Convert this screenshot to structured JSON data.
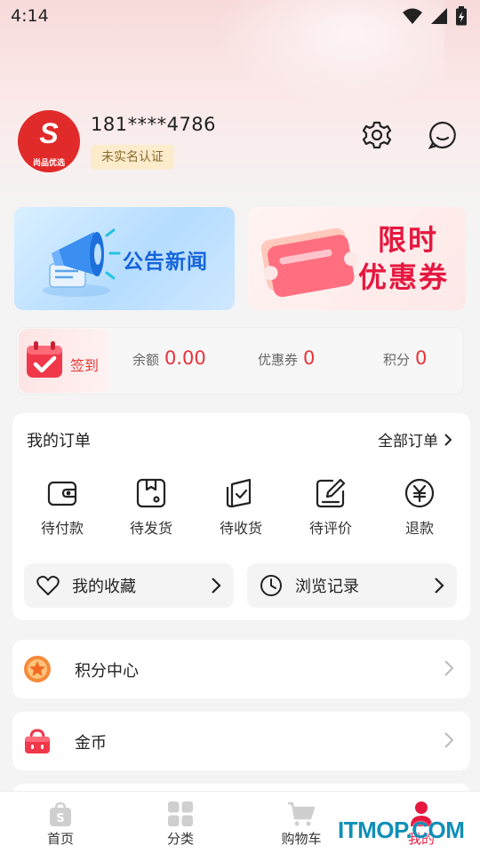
{
  "status_bar": {
    "time": "4:14"
  },
  "profile": {
    "avatar_letter": "S",
    "avatar_text": "尚品优选",
    "phone": "181****4786",
    "verify_badge": "未实名认证"
  },
  "banners": {
    "news": "公告新闻",
    "coupon_line1": "限时",
    "coupon_line2": "优惠券"
  },
  "stats": {
    "signin_label": "签到",
    "balance_label": "余额",
    "balance_value": "0.00",
    "coupon_label": "优惠券",
    "coupon_value": "0",
    "points_label": "积分",
    "points_value": "0"
  },
  "orders": {
    "title": "我的订单",
    "all_label": "全部订单",
    "items": [
      {
        "label": "待付款",
        "icon": "wallet-icon"
      },
      {
        "label": "待发货",
        "icon": "package-icon"
      },
      {
        "label": "待收货",
        "icon": "received-icon"
      },
      {
        "label": "待评价",
        "icon": "review-icon"
      },
      {
        "label": "退款",
        "icon": "yen-icon"
      }
    ],
    "favorites_label": "我的收藏",
    "history_label": "浏览记录"
  },
  "list": {
    "points_center": "积分中心",
    "coins": "金币"
  },
  "tabbar": {
    "items": [
      {
        "label": "首页",
        "icon": "home-bag-icon"
      },
      {
        "label": "分类",
        "icon": "grid-icon"
      },
      {
        "label": "购物车",
        "icon": "cart-icon"
      },
      {
        "label": "我的",
        "icon": "person-icon"
      }
    ],
    "active_color": "#e6183f"
  },
  "watermark": "ITMOP.COM",
  "colors": {
    "accent": "#e8323a",
    "banner_blue": "#1664d9"
  }
}
